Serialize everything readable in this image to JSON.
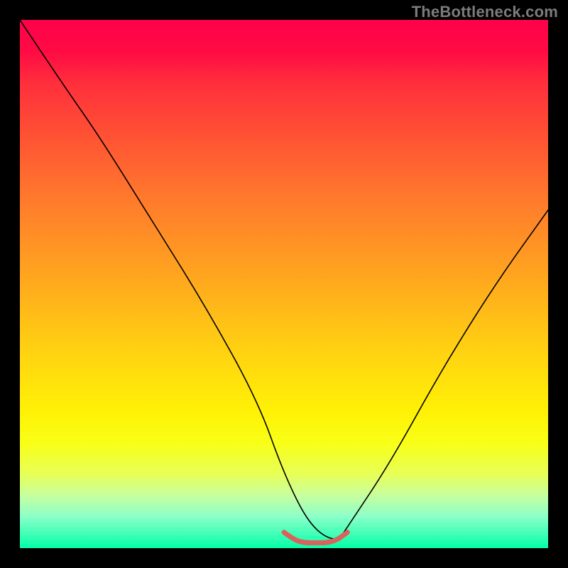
{
  "watermark": "TheBottleneck.com",
  "chart_data": {
    "type": "line",
    "title": "",
    "xlabel": "",
    "ylabel": "",
    "xlim": [
      0,
      100
    ],
    "ylim": [
      0,
      100
    ],
    "background_gradient": {
      "direction": "vertical",
      "stops": [
        {
          "pos": 0,
          "color": "#ff0149"
        },
        {
          "pos": 12,
          "color": "#ff2f3c"
        },
        {
          "pos": 34,
          "color": "#ff7a2c"
        },
        {
          "pos": 62,
          "color": "#ffd012"
        },
        {
          "pos": 80,
          "color": "#f9ff13"
        },
        {
          "pos": 100,
          "color": "#00ffa7"
        }
      ]
    },
    "series": [
      {
        "name": "bottleneck-curve",
        "color": "#000000",
        "x": [
          0,
          8,
          15,
          25,
          35,
          45,
          50,
          55,
          60,
          62,
          70,
          80,
          90,
          100
        ],
        "values": [
          100,
          88,
          78,
          62,
          46,
          28,
          14,
          4,
          1,
          4,
          16,
          34,
          50,
          64
        ]
      },
      {
        "name": "optimal-range-marker",
        "color": "#d9635c",
        "x": [
          50,
          52,
          54,
          56,
          58,
          60,
          62
        ],
        "values": [
          3.0,
          1.5,
          1.0,
          1.0,
          1.0,
          1.5,
          3.0
        ]
      }
    ],
    "annotations": []
  }
}
